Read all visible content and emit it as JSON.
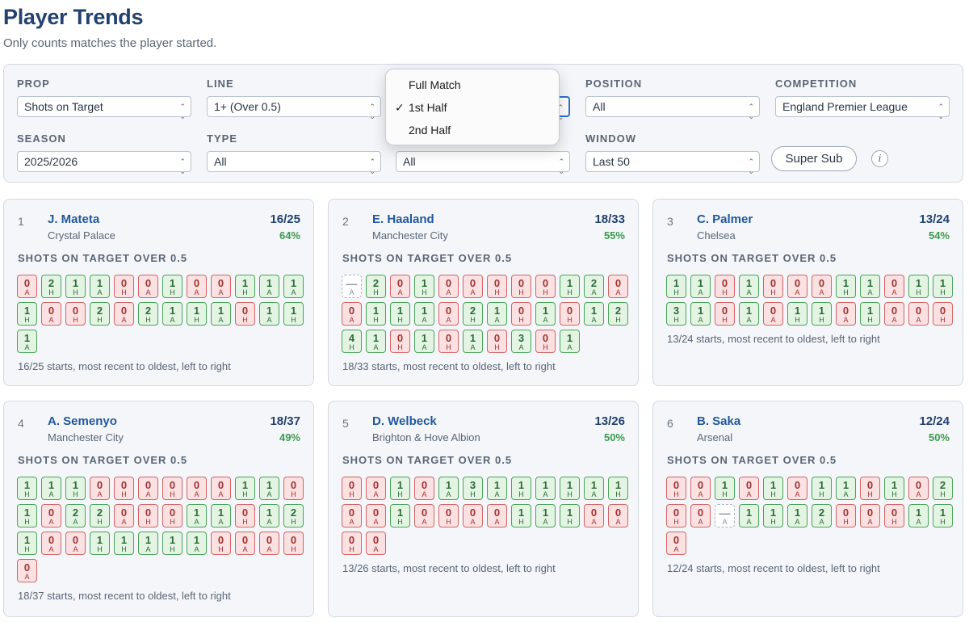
{
  "page": {
    "title": "Player Trends",
    "subtitle": "Only counts matches the player started."
  },
  "filters": {
    "prop": {
      "label": "PROP",
      "value": "Shots on Target"
    },
    "line": {
      "label": "LINE",
      "value": "1+ (Over 0.5)"
    },
    "half": {
      "value": ""
    },
    "position": {
      "label": "POSITION",
      "value": "All"
    },
    "competition": {
      "label": "COMPETITION",
      "value": "England Premier League"
    },
    "season": {
      "label": "SEASON",
      "value": "2025/2026"
    },
    "type": {
      "label": "TYPE",
      "value": "All"
    },
    "venue": {
      "value": "All"
    },
    "window": {
      "label": "WINDOW",
      "value": "Last 50"
    },
    "super_sub_label": "Super Sub",
    "info_label": "i"
  },
  "dropdown": {
    "options": [
      "Full Match",
      "1st Half",
      "2nd Half"
    ],
    "selected_index": 1,
    "check_mark": "✓"
  },
  "colors": {
    "hit": "#4aa35a",
    "miss": "#d26565",
    "title": "#22416f",
    "pct": "#3d9a4d"
  },
  "players": [
    {
      "rank": "1",
      "name": "J. Mateta",
      "team": "Crystal Palace",
      "score": "16/25",
      "pct": "64%",
      "prop": "SHOTS ON TARGET OVER 0.5",
      "matches": [
        [
          "0",
          "A"
        ],
        [
          "2",
          "H"
        ],
        [
          "1",
          "H"
        ],
        [
          "1",
          "A"
        ],
        [
          "0",
          "H"
        ],
        [
          "0",
          "A"
        ],
        [
          "1",
          "H"
        ],
        [
          "0",
          "A"
        ],
        [
          "0",
          "A"
        ],
        [
          "1",
          "H"
        ],
        [
          "1",
          "A"
        ],
        [
          "1",
          "A"
        ],
        [
          "1",
          "H"
        ],
        [
          "0",
          "A"
        ],
        [
          "0",
          "H"
        ],
        [
          "2",
          "H"
        ],
        [
          "0",
          "A"
        ],
        [
          "2",
          "H"
        ],
        [
          "1",
          "A"
        ],
        [
          "1",
          "H"
        ],
        [
          "1",
          "A"
        ],
        [
          "0",
          "H"
        ],
        [
          "1",
          "A"
        ],
        [
          "1",
          "H"
        ],
        [
          "1",
          "A"
        ]
      ],
      "footer": "16/25 starts, most recent to oldest, left to right"
    },
    {
      "rank": "2",
      "name": "E. Haaland",
      "team": "Manchester City",
      "score": "18/33",
      "pct": "55%",
      "prop": "SHOTS ON TARGET OVER 0.5",
      "matches": [
        [
          "—",
          "A"
        ],
        [
          "2",
          "H"
        ],
        [
          "0",
          "A"
        ],
        [
          "1",
          "H"
        ],
        [
          "0",
          "A"
        ],
        [
          "0",
          "A"
        ],
        [
          "0",
          "H"
        ],
        [
          "0",
          "H"
        ],
        [
          "0",
          "H"
        ],
        [
          "1",
          "H"
        ],
        [
          "2",
          "A"
        ],
        [
          "0",
          "A"
        ],
        [
          "0",
          "A"
        ],
        [
          "1",
          "H"
        ],
        [
          "1",
          "H"
        ],
        [
          "1",
          "A"
        ],
        [
          "0",
          "A"
        ],
        [
          "2",
          "H"
        ],
        [
          "1",
          "A"
        ],
        [
          "0",
          "H"
        ],
        [
          "1",
          "A"
        ],
        [
          "0",
          "H"
        ],
        [
          "1",
          "A"
        ],
        [
          "2",
          "H"
        ],
        [
          "4",
          "H"
        ],
        [
          "1",
          "A"
        ],
        [
          "0",
          "H"
        ],
        [
          "1",
          "A"
        ],
        [
          "0",
          "H"
        ],
        [
          "1",
          "A"
        ],
        [
          "0",
          "H"
        ],
        [
          "3",
          "A"
        ],
        [
          "0",
          "H"
        ],
        [
          "1",
          "A"
        ]
      ],
      "footer": "18/33 starts, most recent to oldest, left to right"
    },
    {
      "rank": "3",
      "name": "C. Palmer",
      "team": "Chelsea",
      "score": "13/24",
      "pct": "54%",
      "prop": "SHOTS ON TARGET OVER 0.5",
      "matches": [
        [
          "1",
          "H"
        ],
        [
          "1",
          "A"
        ],
        [
          "0",
          "H"
        ],
        [
          "1",
          "A"
        ],
        [
          "0",
          "H"
        ],
        [
          "0",
          "A"
        ],
        [
          "0",
          "A"
        ],
        [
          "1",
          "H"
        ],
        [
          "1",
          "A"
        ],
        [
          "0",
          "A"
        ],
        [
          "1",
          "H"
        ],
        [
          "1",
          "H"
        ],
        [
          "3",
          "H"
        ],
        [
          "1",
          "A"
        ],
        [
          "0",
          "H"
        ],
        [
          "1",
          "A"
        ],
        [
          "0",
          "A"
        ],
        [
          "1",
          "H"
        ],
        [
          "1",
          "H"
        ],
        [
          "0",
          "A"
        ],
        [
          "1",
          "H"
        ],
        [
          "0",
          "A"
        ],
        [
          "0",
          "A"
        ],
        [
          "0",
          "H"
        ]
      ],
      "footer": "13/24 starts, most recent to oldest, left to right"
    },
    {
      "rank": "4",
      "name": "A. Semenyo",
      "team": "Manchester City",
      "score": "18/37",
      "pct": "49%",
      "prop": "SHOTS ON TARGET OVER 0.5",
      "matches": [
        [
          "1",
          "H"
        ],
        [
          "1",
          "A"
        ],
        [
          "1",
          "H"
        ],
        [
          "0",
          "A"
        ],
        [
          "0",
          "H"
        ],
        [
          "0",
          "A"
        ],
        [
          "0",
          "H"
        ],
        [
          "0",
          "A"
        ],
        [
          "0",
          "A"
        ],
        [
          "1",
          "H"
        ],
        [
          "1",
          "A"
        ],
        [
          "0",
          "H"
        ],
        [
          "1",
          "H"
        ],
        [
          "0",
          "A"
        ],
        [
          "2",
          "A"
        ],
        [
          "2",
          "H"
        ],
        [
          "0",
          "A"
        ],
        [
          "0",
          "H"
        ],
        [
          "0",
          "H"
        ],
        [
          "1",
          "A"
        ],
        [
          "1",
          "A"
        ],
        [
          "0",
          "H"
        ],
        [
          "1",
          "A"
        ],
        [
          "2",
          "H"
        ],
        [
          "1",
          "H"
        ],
        [
          "0",
          "A"
        ],
        [
          "0",
          "A"
        ],
        [
          "1",
          "H"
        ],
        [
          "1",
          "H"
        ],
        [
          "1",
          "A"
        ],
        [
          "1",
          "H"
        ],
        [
          "1",
          "A"
        ],
        [
          "0",
          "H"
        ],
        [
          "0",
          "A"
        ],
        [
          "0",
          "A"
        ],
        [
          "0",
          "H"
        ],
        [
          "0",
          "A"
        ]
      ],
      "footer": "18/37 starts, most recent to oldest, left to right"
    },
    {
      "rank": "5",
      "name": "D. Welbeck",
      "team": "Brighton & Hove Albion",
      "score": "13/26",
      "pct": "50%",
      "prop": "SHOTS ON TARGET OVER 0.5",
      "matches": [
        [
          "0",
          "H"
        ],
        [
          "0",
          "A"
        ],
        [
          "1",
          "H"
        ],
        [
          "0",
          "A"
        ],
        [
          "1",
          "A"
        ],
        [
          "3",
          "H"
        ],
        [
          "1",
          "A"
        ],
        [
          "1",
          "H"
        ],
        [
          "1",
          "A"
        ],
        [
          "1",
          "H"
        ],
        [
          "1",
          "A"
        ],
        [
          "1",
          "H"
        ],
        [
          "0",
          "A"
        ],
        [
          "0",
          "A"
        ],
        [
          "1",
          "H"
        ],
        [
          "0",
          "A"
        ],
        [
          "0",
          "H"
        ],
        [
          "0",
          "A"
        ],
        [
          "0",
          "A"
        ],
        [
          "1",
          "H"
        ],
        [
          "1",
          "A"
        ],
        [
          "1",
          "H"
        ],
        [
          "0",
          "A"
        ],
        [
          "0",
          "A"
        ],
        [
          "0",
          "H"
        ],
        [
          "0",
          "A"
        ]
      ],
      "footer": "13/26 starts, most recent to oldest, left to right"
    },
    {
      "rank": "6",
      "name": "B. Saka",
      "team": "Arsenal",
      "score": "12/24",
      "pct": "50%",
      "prop": "SHOTS ON TARGET OVER 0.5",
      "matches": [
        [
          "0",
          "H"
        ],
        [
          "0",
          "A"
        ],
        [
          "1",
          "H"
        ],
        [
          "0",
          "A"
        ],
        [
          "1",
          "H"
        ],
        [
          "0",
          "A"
        ],
        [
          "1",
          "H"
        ],
        [
          "1",
          "A"
        ],
        [
          "0",
          "H"
        ],
        [
          "1",
          "H"
        ],
        [
          "0",
          "A"
        ],
        [
          "2",
          "H"
        ],
        [
          "0",
          "H"
        ],
        [
          "0",
          "A"
        ],
        [
          "—",
          "A"
        ],
        [
          "1",
          "A"
        ],
        [
          "1",
          "H"
        ],
        [
          "1",
          "A"
        ],
        [
          "2",
          "A"
        ],
        [
          "0",
          "H"
        ],
        [
          "0",
          "A"
        ],
        [
          "0",
          "H"
        ],
        [
          "1",
          "A"
        ],
        [
          "1",
          "H"
        ],
        [
          "0",
          "A"
        ]
      ],
      "footer": "12/24 starts, most recent to oldest, left to right"
    }
  ]
}
